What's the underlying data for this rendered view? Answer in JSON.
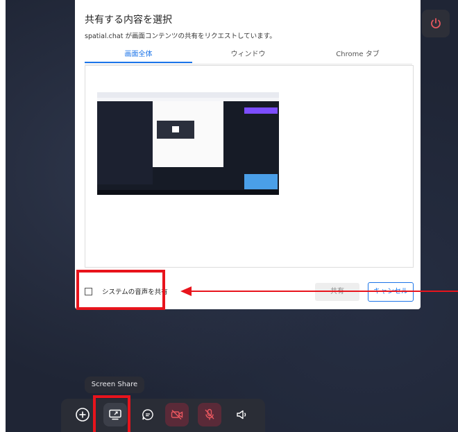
{
  "dialog": {
    "title": "共有する内容を選択",
    "subtitle": "spatial.chat が画面コンテンツの共有をリクエストしています。",
    "tabs": [
      {
        "label": "画面全体",
        "active": true
      },
      {
        "label": "ウィンドウ",
        "active": false
      },
      {
        "label": "Chrome タブ",
        "active": false
      }
    ],
    "share_audio_label": "システムの音声を共有",
    "share_audio_checked": false,
    "share_button": "共有",
    "cancel_button": "キャンセル"
  },
  "tooltip": "Screen Share",
  "toolbar": {
    "items": [
      "add-icon",
      "screen-share-icon",
      "chat-icon",
      "camera-off-icon",
      "mic-off-icon",
      "speaker-icon"
    ]
  },
  "colors": {
    "accent": "#1a73e8",
    "highlight": "#e8141c",
    "toolbar": "#2a2d36",
    "muted_button": "#5a2a38",
    "danger_icon": "#e8575f"
  }
}
